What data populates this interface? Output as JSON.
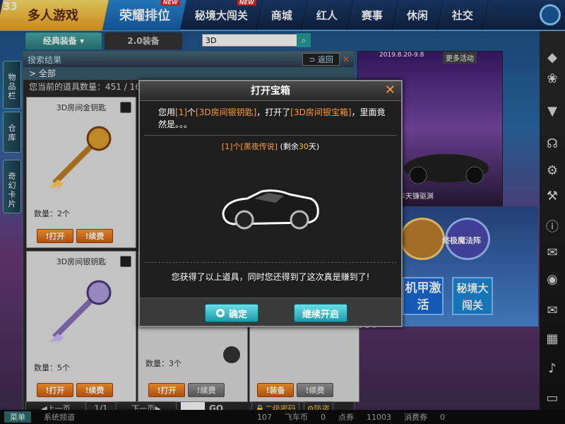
{
  "fps": "33",
  "nav": {
    "tabs": [
      {
        "label": "多人游戏"
      },
      {
        "label": "荣耀排位",
        "badge": "NEW"
      },
      {
        "label": "秘境大闯关",
        "badge": "NEW"
      },
      {
        "label": "商城"
      },
      {
        "label": "红人"
      },
      {
        "label": "赛事"
      },
      {
        "label": "休闲"
      },
      {
        "label": "社交"
      }
    ]
  },
  "subtabs": {
    "classic": "经典装备",
    "v2": "2.0装备"
  },
  "search": {
    "value": "3D"
  },
  "side_tabs": [
    "物品栏",
    "仓库",
    "奇幻卡片"
  ],
  "inventory": {
    "title": "搜索结果",
    "back": "返回",
    "category": "全部",
    "count_text": "您当前的道具数量：451 / 16",
    "items": [
      {
        "name": "3D房间金钥匙",
        "qty": "数量：2个",
        "btn1": "打开",
        "btn2": "续费"
      },
      {
        "name": "3D房间银钥匙",
        "qty": "数量：5个",
        "btn1": "打开",
        "btn2": "续费"
      },
      {
        "name": "",
        "qty": "数量：3个",
        "btn1": "打开",
        "btn2": "续费"
      },
      {
        "name": "",
        "qty": "",
        "btn1": "装备",
        "btn2": "续费"
      }
    ],
    "pager": {
      "prev": "上一页",
      "page": "1/1",
      "next": "下一页",
      "go": "GO",
      "pwd": "二级密码",
      "lock": "防盗"
    }
  },
  "status": {
    "menu": "菜单",
    "channel": "系统频道",
    "val1": "107",
    "coin_label": "飞车币",
    "coin": "0",
    "points_label": "点券",
    "points": "11003",
    "consume_label": "消费券",
    "consume": "0"
  },
  "banner": {
    "more": "更多活动",
    "date": "2019.8.20-9.8",
    "car": "A车天镰驱渊",
    "tiles": [
      "机甲激活",
      "秘境大闯关",
      "终极魔法阵"
    ],
    "pages": "1 2 3"
  },
  "dialog": {
    "title": "打开宝箱",
    "msg_pre": "您用",
    "msg_n1": "[1]",
    "msg_mid1": "个",
    "msg_key": "[3D房间银钥匙]",
    "msg_mid2": "，打开了",
    "msg_box": "[3D房间银宝箱]",
    "msg_end": "，里面竟然是。。。",
    "reward_n": "[1]",
    "reward_mid": "个",
    "reward_name": "[黑夜传说]",
    "reward_remain_pre": " (剩余",
    "reward_days": "30",
    "reward_remain_post": "天)",
    "got_text": "您获得了以上道具，同时您还得到了这次真是赚到了!",
    "ok": "确定",
    "continue": "继续开启"
  }
}
